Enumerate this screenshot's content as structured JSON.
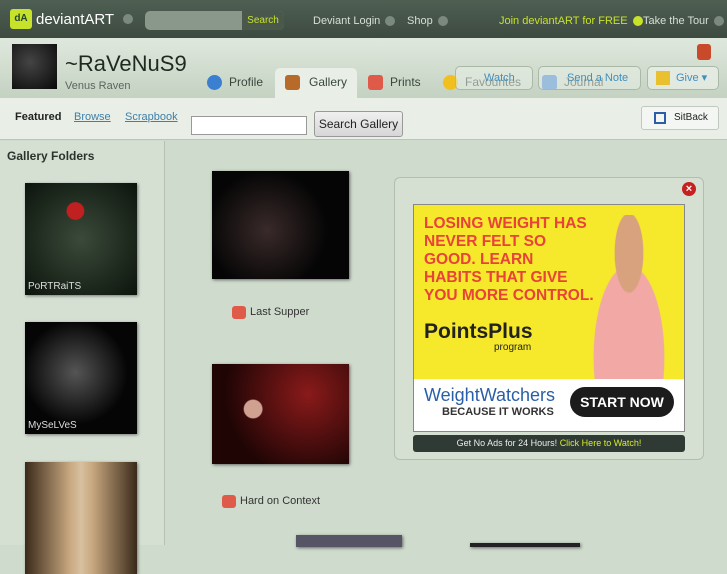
{
  "topbar": {
    "logo": "deviantART",
    "search_button": "Search",
    "search_placeholder": "",
    "links": [
      "Deviant Login",
      "Shop",
      "Join deviantART for FREE",
      "Take the Tour"
    ]
  },
  "profile": {
    "username": "~RaVeNuS9",
    "realname": "Venus Raven"
  },
  "tabs": [
    {
      "label": "Profile"
    },
    {
      "label": "Gallery",
      "active": true
    },
    {
      "label": "Prints"
    },
    {
      "label": "Favourites"
    },
    {
      "label": "Journal"
    }
  ],
  "actions": {
    "watch": "Watch",
    "note": "Send a Note",
    "give": "Give ▾"
  },
  "subnav": {
    "featured": "Featured",
    "browse": "Browse",
    "scrapbook": "Scrapbook",
    "search_value": "",
    "search_button": "Search Gallery",
    "sitback": "SitBack"
  },
  "sidebar": {
    "title": "Gallery Folders",
    "folders": [
      {
        "label": "PoRTRaiTS"
      },
      {
        "label": "MySeLVeS"
      },
      {
        "label": ""
      }
    ]
  },
  "gallery": [
    {
      "title": "Last Supper"
    },
    {
      "title": "Hard on Context"
    }
  ],
  "ad": {
    "headline": "LOSING WEIGHT HAS NEVER FELT SO GOOD. LEARN HABITS THAT GIVE YOU MORE CONTROL.",
    "brand": "PointsPlus",
    "brand_sub": "program",
    "logo": "WeightWatchers",
    "tagline": "BECAUSE IT WORKS",
    "cta": "START NOW",
    "noads_text": "Get No Ads for 24 Hours!",
    "noads_link": "Click Here to Watch!"
  }
}
